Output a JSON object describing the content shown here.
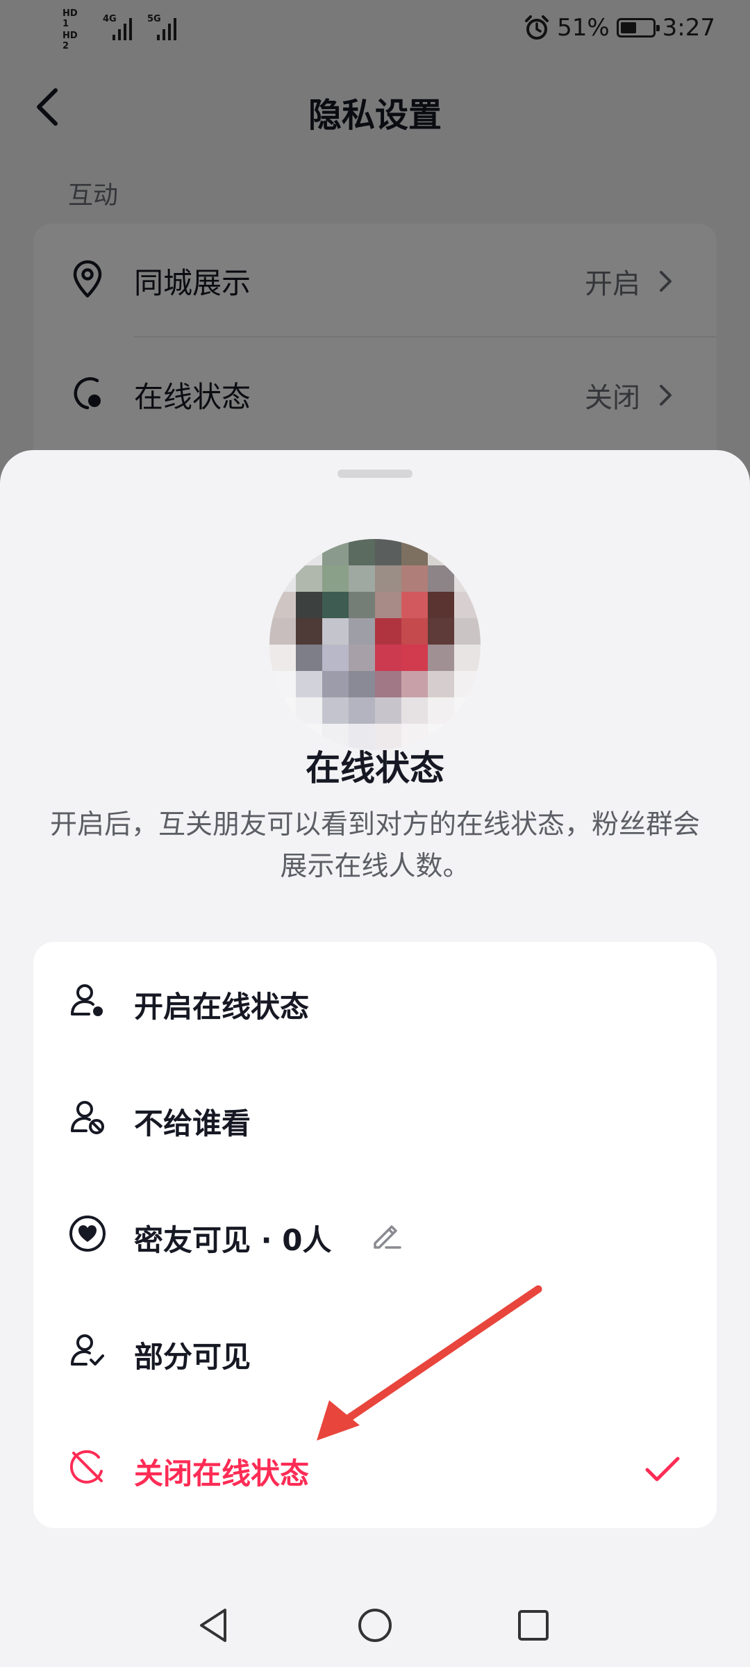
{
  "status_bar": {
    "sim1": "HD 1",
    "sim2": "HD 2",
    "net1": "4G",
    "net2": "5G",
    "battery_pct": "51%",
    "battery_level": 0.51,
    "time": "3:27",
    "alarm_icon": "alarm-clock-icon"
  },
  "nav": {
    "title": "隐私设置",
    "back_icon": "chevron-left-icon"
  },
  "section": {
    "label": "互动"
  },
  "settings": [
    {
      "label": "同城展示",
      "value": "开启",
      "icon": "location-pin-icon"
    },
    {
      "label": "在线状态",
      "value": "关闭",
      "icon": "online-status-icon"
    }
  ],
  "sheet": {
    "title": "在线状态",
    "description": "开启后，互关朋友可以看到对方的在线状态，粉丝群会展示在线人数。",
    "options": [
      {
        "label": "开启在线状态",
        "icon": "user-online-icon"
      },
      {
        "label": "不给谁看",
        "icon": "user-blocked-icon"
      },
      {
        "label": "密友可见 · 0人",
        "icon": "heart-circle-icon"
      },
      {
        "label": "部分可见",
        "icon": "user-check-icon"
      },
      {
        "label": "关闭在线状态",
        "icon": "offline-icon",
        "selected": true
      }
    ]
  },
  "colors": {
    "accent": "#fe2c55",
    "annotation_arrow": "#e8453c",
    "sheet_bg": "#f3f3f5",
    "card_bg": "#ffffff"
  }
}
